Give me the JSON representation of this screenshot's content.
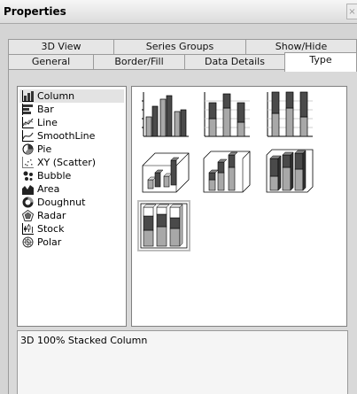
{
  "window": {
    "title": "Properties",
    "close_glyph": "×"
  },
  "tabs": {
    "row1": [
      "3D View",
      "Series Groups",
      "Show/Hide"
    ],
    "row2": [
      "General",
      "Border/Fill",
      "Data Details",
      "Type"
    ],
    "active": "Type"
  },
  "chart_types": [
    {
      "label": "Column",
      "icon": "column-chart-icon",
      "selected": true
    },
    {
      "label": "Bar",
      "icon": "bar-chart-icon"
    },
    {
      "label": "Line",
      "icon": "line-chart-icon"
    },
    {
      "label": "SmoothLine",
      "icon": "smoothline-chart-icon"
    },
    {
      "label": "Pie",
      "icon": "pie-chart-icon"
    },
    {
      "label": "XY (Scatter)",
      "icon": "scatter-chart-icon"
    },
    {
      "label": "Bubble",
      "icon": "bubble-chart-icon"
    },
    {
      "label": "Area",
      "icon": "area-chart-icon"
    },
    {
      "label": "Doughnut",
      "icon": "doughnut-chart-icon"
    },
    {
      "label": "Radar",
      "icon": "radar-chart-icon"
    },
    {
      "label": "Stock",
      "icon": "stock-chart-icon"
    },
    {
      "label": "Polar",
      "icon": "polar-chart-icon"
    }
  ],
  "subtypes": [
    {
      "icon": "clustered-column-icon"
    },
    {
      "icon": "stacked-column-icon"
    },
    {
      "icon": "100-stacked-column-icon"
    },
    {
      "icon": "3d-clustered-column-icon"
    },
    {
      "icon": "3d-stacked-column-icon"
    },
    {
      "icon": "3d-stacked-column-variant-icon"
    },
    {
      "icon": "3d-100-stacked-column-icon",
      "selected": true
    }
  ],
  "description": "3D 100% Stacked Column",
  "colors": {
    "dark_bar": "#4a4a4a",
    "light_bar": "#a8a8a8",
    "panel_bg": "#d4d4d4",
    "selection": "#e3e3e3"
  }
}
